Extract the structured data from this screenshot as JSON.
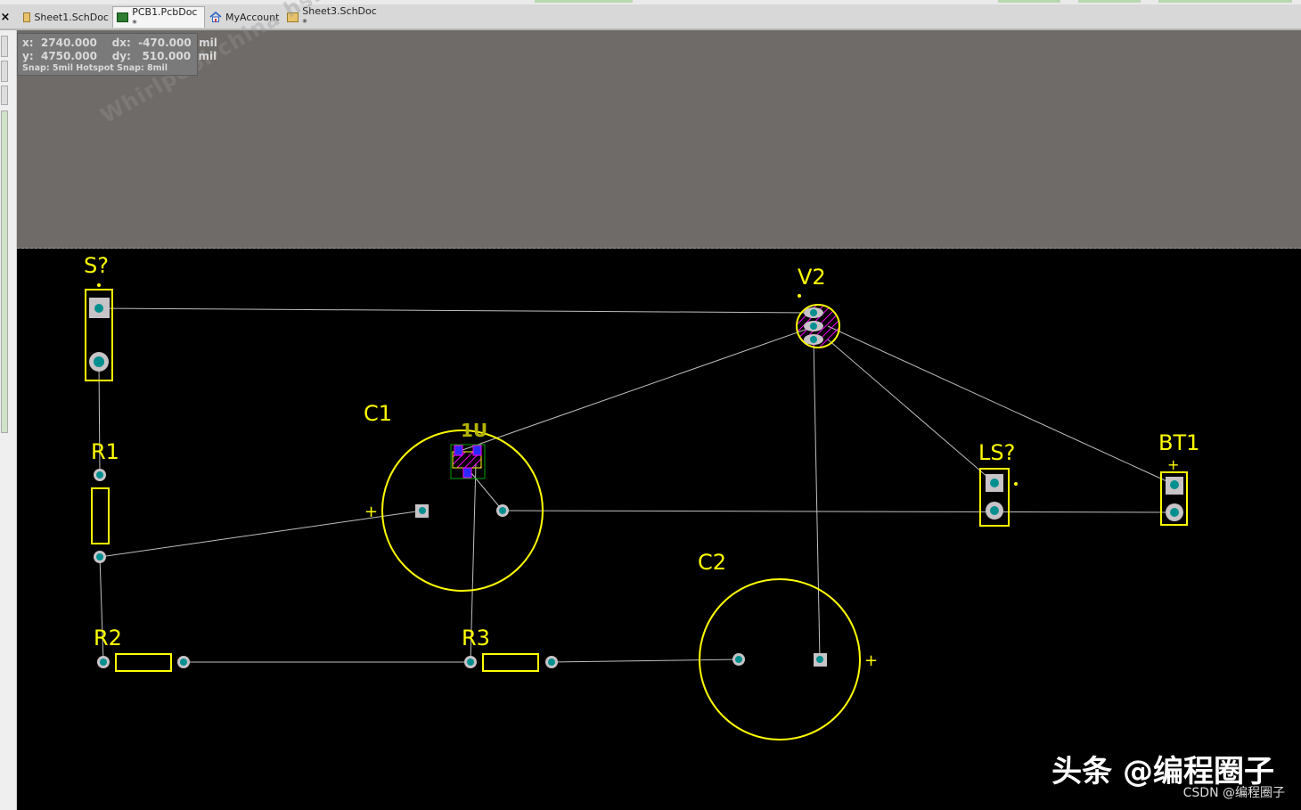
{
  "window": {
    "close_glyph": "×"
  },
  "tabs": [
    {
      "label": "Sheet1.SchDoc",
      "icon": "schematic-doc-icon",
      "active": false
    },
    {
      "label": "PCB1.PcbDoc *",
      "icon": "pcb-doc-icon",
      "active": true
    },
    {
      "label": "MyAccount",
      "icon": "home-icon",
      "active": false
    },
    {
      "label": "Sheet3.SchDoc *",
      "icon": "schematic-doc-icon",
      "active": false
    }
  ],
  "coords": {
    "row1": "x:  2740.000    dx:  -470.000  mil",
    "row2": "y:  4750.000    dy:   510.000  mil",
    "snap": "Snap: 5mil Hotspot Snap: 8mil"
  },
  "watermark": "Whirlpool-china  hs26661",
  "components": {
    "s": "S?",
    "v2": "V2",
    "c1": "C1",
    "c1_value": "1U",
    "r1": "R1",
    "r2": "R2",
    "r3": "R3",
    "c2": "C2",
    "ls": "LS?",
    "bt1": "BT1",
    "plus": "+"
  },
  "brand": {
    "main": "头条 @编程圈子",
    "sub": "CSDN @编程圈子"
  },
  "colors": {
    "silkscreen": "#ffff00",
    "pad": "#c7c3c7",
    "pad_hole": "#008f8f",
    "ratsnest": "#bfbfbf",
    "board_outside": "#6f6b68",
    "board": "#000000"
  }
}
